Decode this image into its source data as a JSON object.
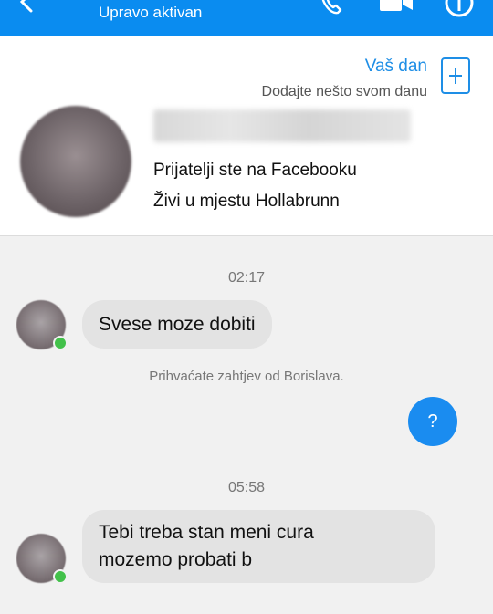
{
  "header": {
    "status": "Upravo aktivan",
    "icons": [
      "back-arrow-icon",
      "phone-icon",
      "video-camera-icon",
      "info-icon"
    ],
    "accent_color": "#0a8cf0"
  },
  "story": {
    "title": "Vaš dan",
    "subtitle": "Dodajte nešto svom danu",
    "accent_color": "#1e8ee6"
  },
  "profile": {
    "line1": "Prijatelji ste na Facebooku",
    "line2": "Živi u mjestu Hollabrunn"
  },
  "conversation": {
    "time1": "02:17",
    "msg1": "Svese moze dobiti",
    "notice": "Prihvaćate zahtjev od Borislava.",
    "my_msg": "?",
    "time2": "05:58",
    "msg2_line1": "Tebi treba stan meni cura",
    "msg2_line2": "mozemo probati b"
  }
}
